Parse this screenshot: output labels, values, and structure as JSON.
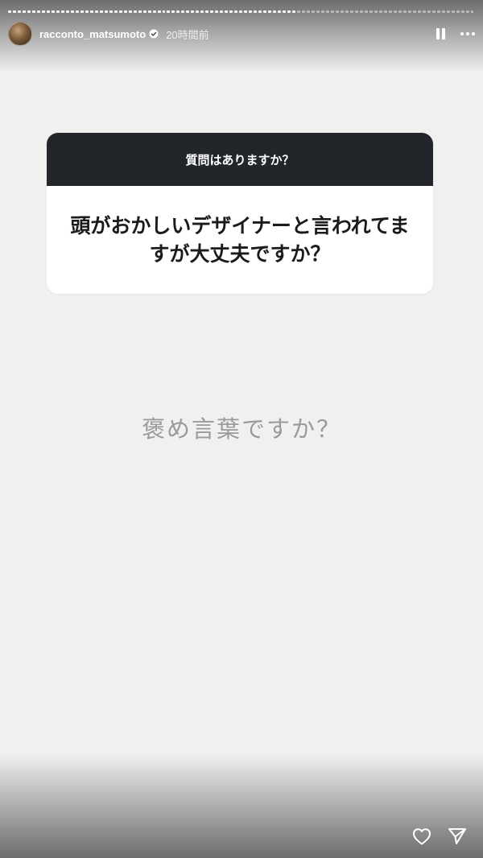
{
  "story": {
    "progress_segments": [
      {
        "done": true
      },
      {
        "done": true
      },
      {
        "done": true
      },
      {
        "done": true
      },
      {
        "done": true
      },
      {
        "done": true
      },
      {
        "done": true
      },
      {
        "done": true
      },
      {
        "done": true
      },
      {
        "done": true
      },
      {
        "done": true
      },
      {
        "done": true
      },
      {
        "done": true
      },
      {
        "done": true
      },
      {
        "done": true
      },
      {
        "done": true
      },
      {
        "done": true
      },
      {
        "done": true
      },
      {
        "done": true
      },
      {
        "done": true
      },
      {
        "done": true
      },
      {
        "done": true
      },
      {
        "done": true
      },
      {
        "done": true
      },
      {
        "done": true
      },
      {
        "done": true
      },
      {
        "done": true
      },
      {
        "done": true
      },
      {
        "done": true
      },
      {
        "done": true
      },
      {
        "done": true
      },
      {
        "done": true
      },
      {
        "done": true
      },
      {
        "done": true
      },
      {
        "done": true
      },
      {
        "done": true
      },
      {
        "done": true
      },
      {
        "done": true
      },
      {
        "done": true
      },
      {
        "done": true
      },
      {
        "done": true
      },
      {
        "done": true
      },
      {
        "done": true
      },
      {
        "done": true
      },
      {
        "done": true
      },
      {
        "done": true
      },
      {
        "done": true
      },
      {
        "done": true
      },
      {
        "done": true
      },
      {
        "done": true
      },
      {
        "done": true
      },
      {
        "done": true
      },
      {
        "done": true
      },
      {
        "done": true
      },
      {
        "done": true
      },
      {
        "done": true
      },
      {
        "done": true
      },
      {
        "done": true
      },
      {
        "done": true
      },
      {
        "done": true
      },
      {
        "done": false
      },
      {
        "done": false
      },
      {
        "done": false
      },
      {
        "done": false
      },
      {
        "done": false
      },
      {
        "done": false
      },
      {
        "done": false
      },
      {
        "done": false
      },
      {
        "done": false
      },
      {
        "done": false
      },
      {
        "done": false
      },
      {
        "done": false
      },
      {
        "done": false
      },
      {
        "done": false
      },
      {
        "done": false
      },
      {
        "done": false
      },
      {
        "done": false
      },
      {
        "done": false
      },
      {
        "done": false
      },
      {
        "done": false
      },
      {
        "done": false
      },
      {
        "done": false
      },
      {
        "done": false
      },
      {
        "done": false
      },
      {
        "done": false
      },
      {
        "done": false
      },
      {
        "done": false
      },
      {
        "done": false
      },
      {
        "done": false
      },
      {
        "done": false
      },
      {
        "done": false
      },
      {
        "done": false
      },
      {
        "done": false
      },
      {
        "done": false
      },
      {
        "done": false
      },
      {
        "done": false
      },
      {
        "done": false
      }
    ]
  },
  "header": {
    "username": "racconto_matsumoto",
    "verified": true,
    "timestamp": "20時間前",
    "icons": {
      "pause": "pause-icon",
      "more": "more-icon",
      "verified": "verified-badge-icon"
    }
  },
  "question_box": {
    "title": "質問はありますか？",
    "question": "頭がおかしいデザイナーと言われてますが大丈夫ですか？",
    "header_color": "#22262b"
  },
  "answer": {
    "text": "褒め言葉ですか？"
  },
  "footer": {
    "icons": {
      "like": "heart-icon",
      "share": "send-icon"
    }
  },
  "colors": {
    "background": "#f0f0f0",
    "verified_blue": "#3897f0"
  }
}
